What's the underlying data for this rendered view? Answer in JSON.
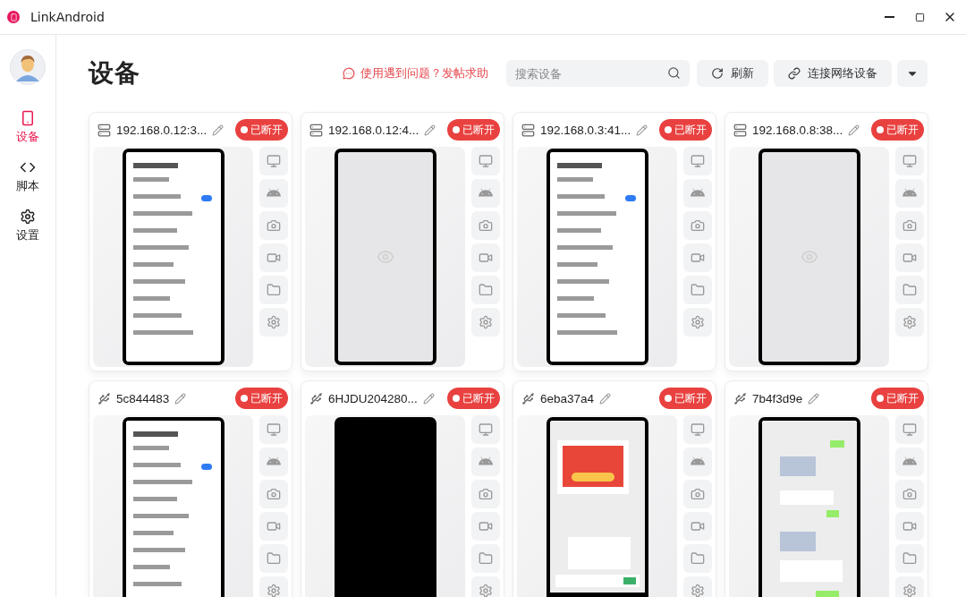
{
  "window": {
    "title": "LinkAndroid"
  },
  "sidebar": {
    "items": [
      {
        "label": "设备",
        "selected": true,
        "kind": "devices"
      },
      {
        "label": "脚本",
        "selected": false,
        "kind": "scripts"
      },
      {
        "label": "设置",
        "selected": false,
        "kind": "settings"
      }
    ]
  },
  "page": {
    "title": "设备",
    "help_link": "使用遇到问题？发帖求助",
    "search": {
      "placeholder": "搜索设备"
    },
    "buttons": [
      {
        "label": "刷新",
        "kind": "refresh"
      },
      {
        "label": "连接网络设备",
        "kind": "link"
      },
      {
        "kind": "menu"
      }
    ]
  },
  "devices": [
    {
      "kind": "network",
      "name": "192.168.0.12:3...",
      "status": "已断开"
    },
    {
      "kind": "network",
      "name": "192.168.0.12:4...",
      "status": "已断开",
      "screen": {
        "kind": "placeholder"
      }
    },
    {
      "kind": "network",
      "name": "192.168.0.3:41...",
      "status": "已断开"
    },
    {
      "kind": "network",
      "name": "192.168.0.8:38...",
      "status": "已断开",
      "screen": {
        "kind": "placeholder"
      }
    },
    {
      "kind": "usb",
      "name": "5c844483",
      "status": "已断开"
    },
    {
      "kind": "usb",
      "name": "6HJDU204280...",
      "status": "已断开",
      "screen": {
        "kind": "black"
      }
    },
    {
      "kind": "usb",
      "name": "6eba37a4",
      "status": "已断开"
    },
    {
      "kind": "usb",
      "name": "7b4f3d9e",
      "status": "已断开"
    }
  ]
}
